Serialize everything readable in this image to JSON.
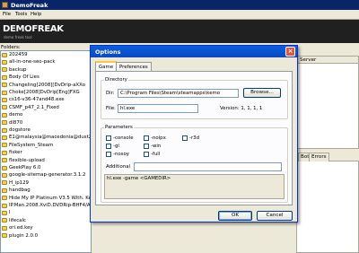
{
  "window": {
    "title": "DemoFreak"
  },
  "menu": [
    "File",
    "Tools",
    "Help"
  ],
  "logo": {
    "text": "DEMOFREAK",
    "tagline": "demo freak tool"
  },
  "folders": {
    "label": "Folders:",
    "items": [
      "202459",
      "all-in-one-seo-pack",
      "backup",
      "Body Of Lies",
      "Changeling[2008][DvDrip-aXXo",
      "Choke[2008]DvDrip[Eng]FXG",
      "cs16-v36-47and48.exe",
      "CSMF_p47_2.1_Fixed",
      "demo",
      "dl870",
      "dogstore",
      "E1@malaysia@macedonia@dust2",
      "FileSystem_Steam",
      "fisker",
      "flexible-upload",
      "GeekPlay 6.0",
      "google-sitemap-generator.3.1.2",
      "H_ip129",
      "handbag",
      "Hide My IP Platinum V3.5 With. Ke",
      "IP.Man.2008.XviD.DVDRip-BHF4/A",
      "l",
      "lifecalc",
      "ori.ed.key",
      "plugin 2.0.0"
    ]
  },
  "background": {
    "server_header": "Server",
    "tabs": [
      "Bot",
      "Errors"
    ]
  },
  "dialog": {
    "title": "Options",
    "close": "×",
    "tabs": [
      "Game",
      "Preferences"
    ],
    "directory": {
      "group_label": "Directory",
      "dir_label": "Dir:",
      "dir_value": "C:\\Program Files\\Steam\\steamapps\\kemo",
      "browse_label": "Browse...",
      "file_label": "File:",
      "file_value": "hl.exe",
      "version_text": "Version: 1, 1, 1, 1"
    },
    "parameters": {
      "group_label": "Parameters",
      "checkboxes": [
        "-console",
        "-noipx",
        "-r3d",
        "-gl",
        "-win",
        "-nosoy",
        "-full"
      ],
      "additional_label": "Additional",
      "additional_value": "",
      "command_text": "hl.exe -game <GAMEDIR>"
    },
    "buttons": {
      "ok": "OK",
      "cancel": "Cancel"
    }
  }
}
